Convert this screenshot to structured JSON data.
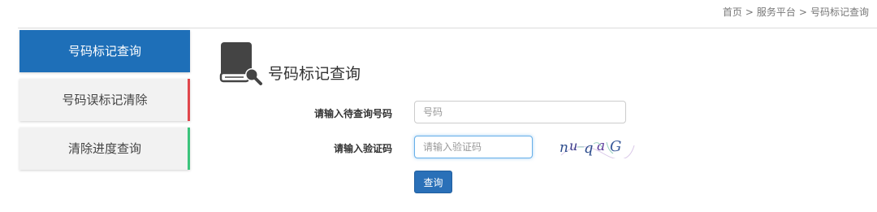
{
  "breadcrumb": {
    "home": "首页",
    "separator": ">",
    "service_platform": "服务平台",
    "current": "号码标记查询"
  },
  "sidebar": {
    "items": [
      {
        "label": "号码标记查询",
        "active": true,
        "accent_color": "#1e6fb8"
      },
      {
        "label": "号码误标记清除",
        "active": false,
        "accent_color": "#e0474c"
      },
      {
        "label": "清除进度查询",
        "active": false,
        "accent_color": "#3cc47c"
      }
    ]
  },
  "main": {
    "title": "号码标记查询",
    "icon": "book-search-icon",
    "form": {
      "phone_label": "请输入待查询号码",
      "phone_placeholder": "号码",
      "code_label": "请输入验证码",
      "code_placeholder": "请输入验证码",
      "captcha_text": "nuqaG",
      "query_button": "查询"
    }
  },
  "colors": {
    "primary": "#1e6fb8",
    "button": "#2a70b8",
    "danger_accent": "#e0474c",
    "success_accent": "#3cc47c"
  }
}
